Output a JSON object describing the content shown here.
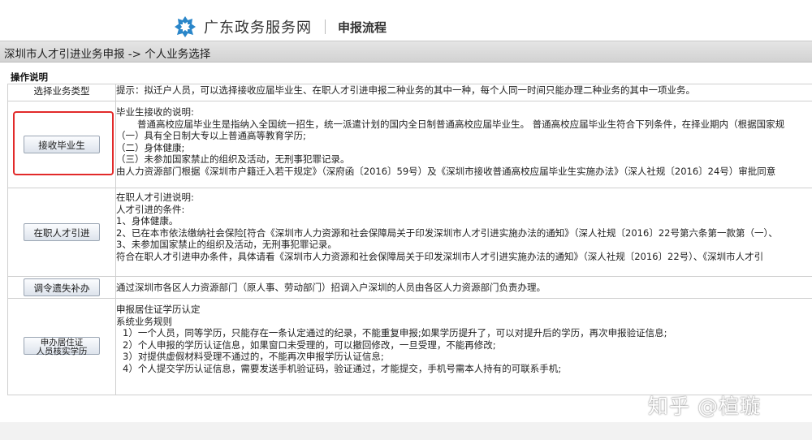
{
  "header": {
    "site_name": "广东政务服务网",
    "flow_title": "申报流程"
  },
  "breadcrumb": "深圳市人才引进业务申报 -> 个人业务选择",
  "section_title": "操作说明",
  "table": {
    "header_label": "选择业务类型",
    "header_tip": "提示：拟迁户人员，可以选择接收应届毕业生、在职人才引进申报二种业务的其中一种，每个人同一时间只能办理二种业务的其中一项业务。"
  },
  "rows": [
    {
      "button": "接收毕业生",
      "lines": [
        "毕业生接收的说明:",
        "普通高校应届毕业生是指纳入全国统一招生，统一派遣计划的国内全日制普通高校应届毕业生。 普通高校应届毕业生符合下列条件，在择业期内（根据国家规",
        "（一）具有全日制大专以上普通高等教育学历;",
        "（二）身体健康;",
        "（三）未参加国家禁止的组织及活动，无刑事犯罪记录。",
        "由人力资源部门根据《深圳市户籍迁入若干规定》（深府函〔2016〕59号）及《深圳市接收普通高校应届毕业生实施办法》（深人社规〔2016〕24号）审批同意"
      ]
    },
    {
      "button": "在职人才引进",
      "lines": [
        "在职人才引进说明:",
        "人才引进的条件:",
        "1、身体健康。",
        "2、已在本市依法缴纳社会保险[符合《深圳市人力资源和社会保障局关于印发深圳市人才引进实施办法的通知》（深人社规〔2016〕22号第六条第一款第（一）、",
        "3、未参加国家禁止的组织及活动，无刑事犯罪记录。",
        "符合在职人才引进申办条件，具体请看《深圳市人力资源和社会保障局关于印发深圳市人才引进实施办法的通知》（深人社规〔2016〕22号）、《深圳市人才引"
      ]
    },
    {
      "button": "调令遗失补办",
      "lines": [
        "通过深圳市各区人力资源部门（原人事、劳动部门）招调入户深圳的人员由各区人力资源部门负责办理。"
      ]
    },
    {
      "button_line1": "申办居住证",
      "button_line2": "人员核实学历",
      "lines": [
        "申报居住证学历认定",
        "系统业务规则",
        "1）一个人员，同等学历，只能存在一条认定通过的纪录，不能重复申报;如果学历提升了，可以对提升后的学历，再次申报验证信息;",
        "2）个人申报的学历认证信息，如果窗口未受理的，可以撤回修改，一旦受理，不能再修改;",
        "3）对提供虚假材料受理不通过的，不能再次申报学历认证信息;",
        "4）个人提交学历认证信息，需要发送手机验证码，验证通过，才能提交，手机号需本人持有的可联系手机;"
      ]
    }
  ],
  "watermark": "知乎 @楦璇",
  "colors": {
    "highlight": "#e22a2a",
    "logo_blue": "#2a86c9"
  }
}
